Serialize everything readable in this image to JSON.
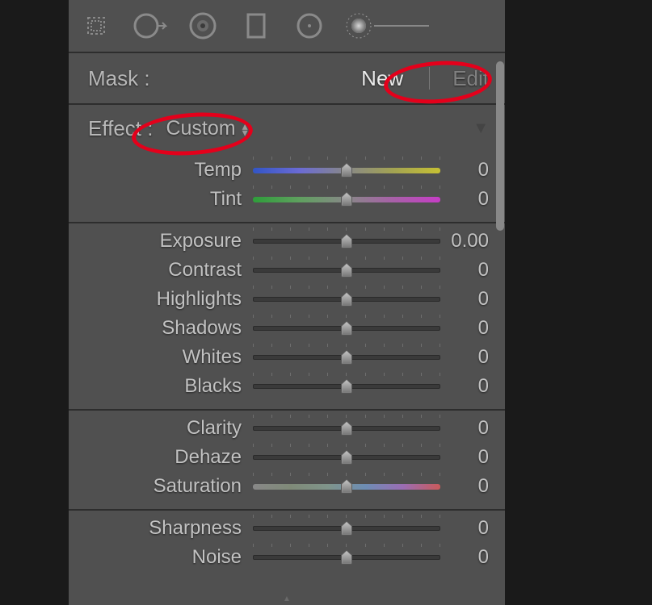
{
  "toolbar": {
    "tools": {
      "crop": "crop-tool",
      "spot": "spot-removal-tool",
      "redeye": "red-eye-tool",
      "graduated": "graduated-filter-tool",
      "radial": "radial-filter-tool",
      "brush": "adjustment-brush-tool"
    }
  },
  "mask": {
    "label": "Mask :",
    "new_label": "New",
    "edit_label": "Edit"
  },
  "effect": {
    "label": "Effect :",
    "value": "Custom"
  },
  "groups": [
    {
      "id": "wb",
      "sliders": [
        {
          "id": "temp",
          "label": "Temp",
          "value": "0",
          "track": "temp"
        },
        {
          "id": "tint",
          "label": "Tint",
          "value": "0",
          "track": "tint"
        }
      ]
    },
    {
      "id": "tone",
      "sliders": [
        {
          "id": "exposure",
          "label": "Exposure",
          "value": "0.00",
          "track": "plain"
        },
        {
          "id": "contrast",
          "label": "Contrast",
          "value": "0",
          "track": "plain"
        },
        {
          "id": "highlights",
          "label": "Highlights",
          "value": "0",
          "track": "plain"
        },
        {
          "id": "shadows",
          "label": "Shadows",
          "value": "0",
          "track": "plain"
        },
        {
          "id": "whites",
          "label": "Whites",
          "value": "0",
          "track": "plain"
        },
        {
          "id": "blacks",
          "label": "Blacks",
          "value": "0",
          "track": "plain"
        }
      ]
    },
    {
      "id": "presence",
      "sliders": [
        {
          "id": "clarity",
          "label": "Clarity",
          "value": "0",
          "track": "plain"
        },
        {
          "id": "dehaze",
          "label": "Dehaze",
          "value": "0",
          "track": "plain"
        },
        {
          "id": "saturation",
          "label": "Saturation",
          "value": "0",
          "track": "sat"
        }
      ]
    },
    {
      "id": "detail",
      "sliders": [
        {
          "id": "sharpness",
          "label": "Sharpness",
          "value": "0",
          "track": "plain"
        },
        {
          "id": "noise",
          "label": "Noise",
          "value": "0",
          "track": "plain"
        }
      ]
    }
  ],
  "annotations": {
    "highlight_new": true,
    "highlight_effect": true,
    "color": "#e4001b"
  }
}
